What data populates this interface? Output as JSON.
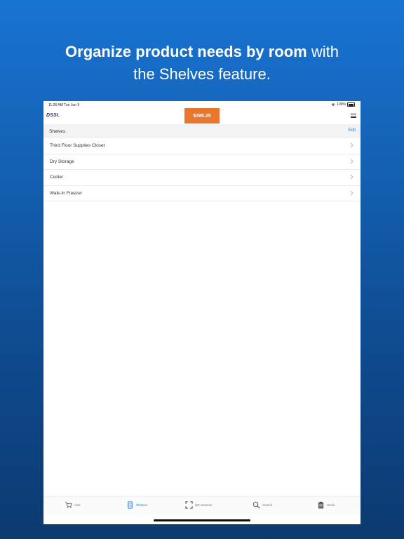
{
  "headline": {
    "bold": "Organize product needs by room",
    "regular": " with",
    "line2": "the Shelves feature."
  },
  "status_bar": {
    "time": "11:26 AM  Tue Jun 9",
    "battery": "100%"
  },
  "header": {
    "logo": "DSSI.",
    "cart_total": "$495.25"
  },
  "section": {
    "title": "Shelves",
    "edit_label": "Edit"
  },
  "shelves": [
    {
      "label": "Third Floor Supplies Closet"
    },
    {
      "label": "Dry Storage"
    },
    {
      "label": "Cooler"
    },
    {
      "label": "Walk-In Freezer"
    }
  ],
  "tabs": [
    {
      "label": "Cart",
      "icon": "cart-icon",
      "active": false
    },
    {
      "label": "Shelves",
      "icon": "shelves-icon",
      "active": true
    },
    {
      "label": "QR Scanner",
      "icon": "scanner-icon",
      "active": false
    },
    {
      "label": "Search",
      "icon": "search-icon",
      "active": false
    },
    {
      "label": "Stock",
      "icon": "clipboard-icon",
      "active": false
    }
  ],
  "colors": {
    "accent": "#2a7ad4",
    "cart_button": "#e8762c",
    "background_top": "#1874d2",
    "background_bottom": "#0c3a70"
  }
}
